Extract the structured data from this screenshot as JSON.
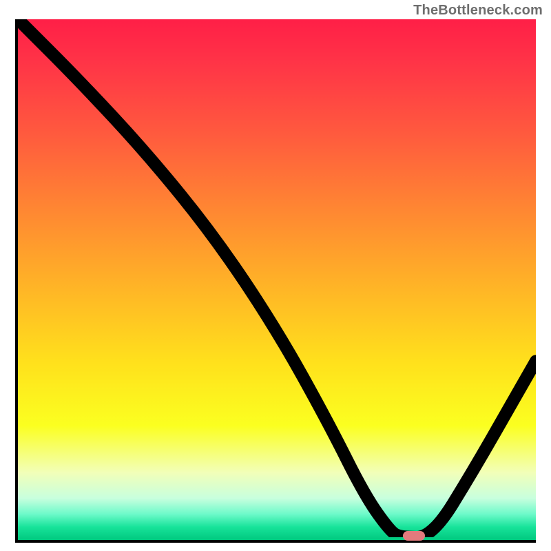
{
  "attribution": "TheBottleneck.com",
  "chart_data": {
    "type": "line",
    "title": "",
    "xlabel": "",
    "ylabel": "",
    "xlim": [
      0,
      100
    ],
    "ylim": [
      0,
      100
    ],
    "grid": false,
    "legend": false,
    "series": [
      {
        "name": "curve",
        "x": [
          0,
          12,
          25,
          38,
          50,
          60,
          67,
          72,
          74,
          80,
          88,
          96,
          100
        ],
        "values": [
          100,
          88,
          74,
          58,
          40,
          22,
          8,
          1,
          0,
          0,
          13,
          27,
          34
        ]
      }
    ],
    "marker": {
      "x": 76.5,
      "y": 0.8
    },
    "background_gradient_stops": [
      {
        "pct": 0,
        "color": "#ff1f47"
      },
      {
        "pct": 8,
        "color": "#ff3347"
      },
      {
        "pct": 22,
        "color": "#ff5a3e"
      },
      {
        "pct": 38,
        "color": "#ff8b31"
      },
      {
        "pct": 52,
        "color": "#ffb626"
      },
      {
        "pct": 66,
        "color": "#ffe11c"
      },
      {
        "pct": 78,
        "color": "#fbff20"
      },
      {
        "pct": 87,
        "color": "#f2ffb8"
      },
      {
        "pct": 92,
        "color": "#c8ffde"
      },
      {
        "pct": 95,
        "color": "#6efaca"
      },
      {
        "pct": 97.5,
        "color": "#18e39a"
      },
      {
        "pct": 100,
        "color": "#00c97f"
      }
    ]
  }
}
